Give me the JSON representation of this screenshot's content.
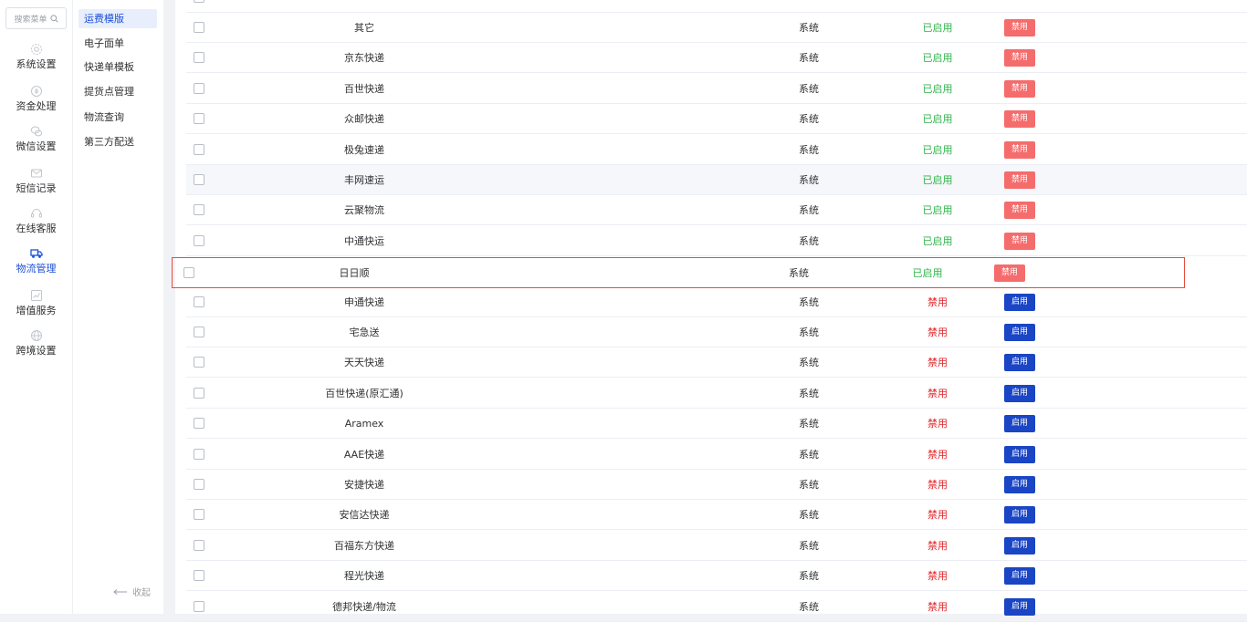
{
  "search": {
    "placeholder": "搜索菜单"
  },
  "primary_nav": [
    {
      "label": "系统设置",
      "icon": "gear-icon"
    },
    {
      "label": "资金处理",
      "icon": "coin-icon"
    },
    {
      "label": "微信设置",
      "icon": "wechat-icon"
    },
    {
      "label": "短信记录",
      "icon": "mail-icon"
    },
    {
      "label": "在线客服",
      "icon": "headset-icon"
    },
    {
      "label": "物流管理",
      "icon": "truck-icon",
      "active": true
    },
    {
      "label": "增值服务",
      "icon": "chart-icon"
    },
    {
      "label": "跨境设置",
      "icon": "globe-icon"
    }
  ],
  "secondary_nav": [
    {
      "label": "运费模版",
      "active": true
    },
    {
      "label": "电子面单"
    },
    {
      "label": "快递单模板"
    },
    {
      "label": "提货点管理"
    },
    {
      "label": "物流查询"
    },
    {
      "label": "第三方配送"
    }
  ],
  "collapse_label": "收起",
  "labels": {
    "enabled": "已启用",
    "disabled": "禁用",
    "btn_disable": "禁用",
    "btn_enable": "启用"
  },
  "rows": [
    {
      "name": "其它",
      "type": "系统",
      "enabled": true
    },
    {
      "name": "京东快递",
      "type": "系统",
      "enabled": true
    },
    {
      "name": "百世快递",
      "type": "系统",
      "enabled": true
    },
    {
      "name": "众邮快递",
      "type": "系统",
      "enabled": true
    },
    {
      "name": "极兔速递",
      "type": "系统",
      "enabled": true
    },
    {
      "name": "丰网速运",
      "type": "系统",
      "enabled": true,
      "hover": true
    },
    {
      "name": "云聚物流",
      "type": "系统",
      "enabled": true
    },
    {
      "name": "中通快运",
      "type": "系统",
      "enabled": true
    },
    {
      "name": "日日顺",
      "type": "系统",
      "enabled": true,
      "highlight": true
    },
    {
      "name": "申通快递",
      "type": "系统",
      "enabled": false
    },
    {
      "name": "宅急送",
      "type": "系统",
      "enabled": false
    },
    {
      "name": "天天快递",
      "type": "系统",
      "enabled": false
    },
    {
      "name": "百世快递(原汇通)",
      "type": "系统",
      "enabled": false
    },
    {
      "name": "Aramex",
      "type": "系统",
      "enabled": false
    },
    {
      "name": "AAE快递",
      "type": "系统",
      "enabled": false
    },
    {
      "name": "安捷快递",
      "type": "系统",
      "enabled": false
    },
    {
      "name": "安信达快递",
      "type": "系统",
      "enabled": false
    },
    {
      "name": "百福东方快递",
      "type": "系统",
      "enabled": false
    },
    {
      "name": "程光快递",
      "type": "系统",
      "enabled": false
    },
    {
      "name": "德邦快递/物流",
      "type": "系统",
      "enabled": false
    }
  ]
}
